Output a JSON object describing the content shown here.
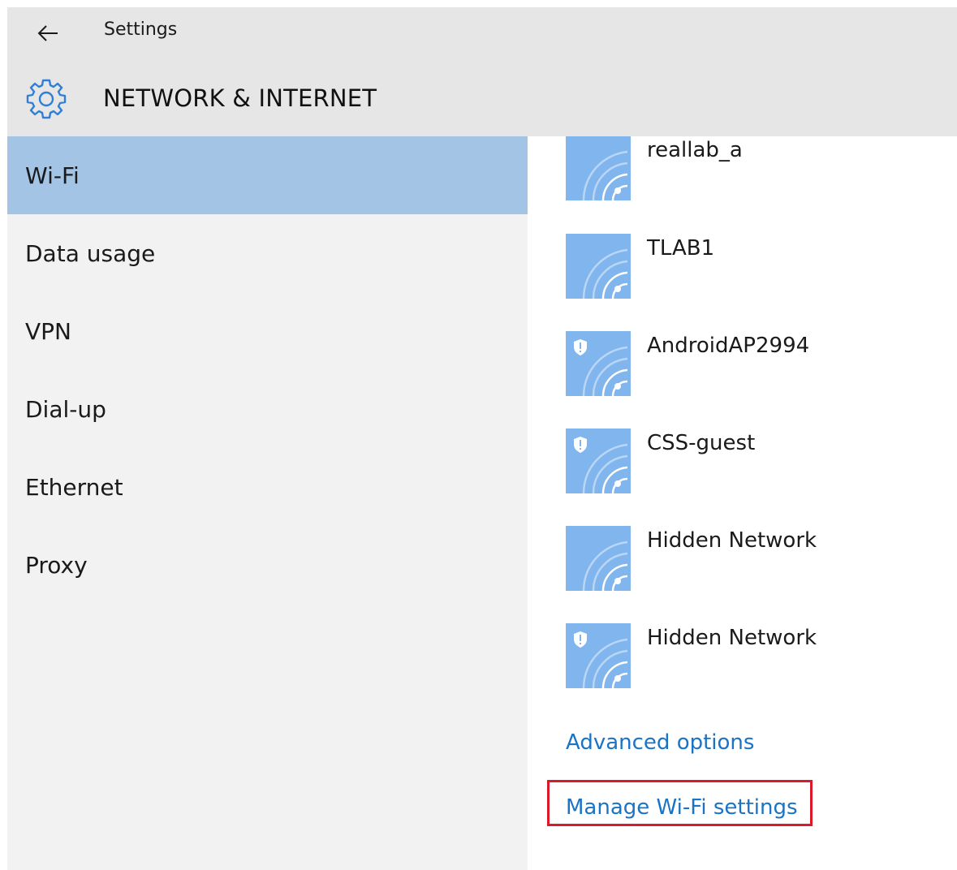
{
  "header": {
    "app_title": "Settings",
    "section_title": "NETWORK & INTERNET"
  },
  "sidebar": {
    "items": [
      {
        "label": "Wi-Fi",
        "selected": true
      },
      {
        "label": "Data usage",
        "selected": false
      },
      {
        "label": "VPN",
        "selected": false
      },
      {
        "label": "Dial-up",
        "selected": false
      },
      {
        "label": "Ethernet",
        "selected": false
      },
      {
        "label": "Proxy",
        "selected": false
      }
    ]
  },
  "networks": [
    {
      "name": "reallab_a",
      "secured": false
    },
    {
      "name": "TLAB1",
      "secured": false
    },
    {
      "name": "AndroidAP2994",
      "secured": true
    },
    {
      "name": "CSS-guest",
      "secured": true
    },
    {
      "name": "Hidden Network",
      "secured": false
    },
    {
      "name": "Hidden Network",
      "secured": true
    }
  ],
  "links": {
    "advanced_options": "Advanced options",
    "manage_wifi": "Manage Wi-Fi settings"
  },
  "colors": {
    "header_bg": "#e6e6e6",
    "sidebar_bg": "#f2f2f2",
    "selected_bg": "#a3c4e4",
    "tile_bg": "#80b5ee",
    "link": "#1a73c4",
    "accent_blue": "#2f7fd8",
    "highlight_red": "#d81a2b"
  },
  "icons": {
    "back": "back-arrow-icon",
    "settings": "gear-icon",
    "network": "wifi-signal-icon",
    "security": "shield-icon"
  }
}
